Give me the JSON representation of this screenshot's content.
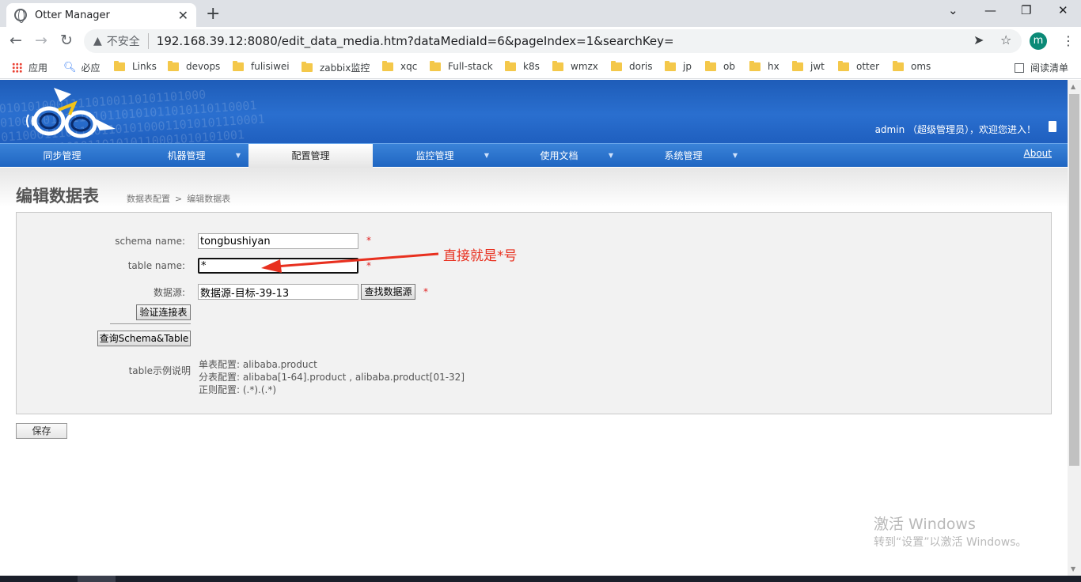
{
  "browser": {
    "tab_title": "Otter Manager",
    "tab_close": "✕",
    "new_tab": "+",
    "window_controls": {
      "minimize": "⌄",
      "restore": "—",
      "maximize": "❐",
      "close": "✕"
    },
    "security_label": "不安全",
    "url": "192.168.39.12:8080/edit_data_media.htm?dataMediaId=6&pageIndex=1&searchKey=",
    "profile_initial": "m",
    "bookmarks": [
      "应用",
      "必应",
      "Links",
      "devops",
      "fulisiwei",
      "zabbix监控",
      "xqc",
      "Full-stack",
      "k8s",
      "wmzx",
      "doris",
      "jp",
      "ob",
      "hx",
      "jwt",
      "otter",
      "oms"
    ],
    "reading_list": "阅读清单"
  },
  "header": {
    "welcome": "admin （超级管理员），欢迎您进入！"
  },
  "nav": {
    "items": [
      {
        "label": "同步管理",
        "has_menu": false
      },
      {
        "label": "机器管理",
        "has_menu": true
      },
      {
        "label": "配置管理",
        "has_menu": false,
        "active": true
      },
      {
        "label": "监控管理",
        "has_menu": true
      },
      {
        "label": "使用文档",
        "has_menu": true
      },
      {
        "label": "系统管理",
        "has_menu": true
      }
    ],
    "about": "About"
  },
  "page": {
    "title": "编辑数据表",
    "breadcrumb": {
      "parent": "数据表配置",
      "separator": ">",
      "current": "编辑数据表"
    }
  },
  "form": {
    "schema_label": "schema name:",
    "schema_value": "tongbushiyan",
    "table_label": "table name:",
    "table_value": "*",
    "source_label": "数据源:",
    "source_value": "数据源-目标-39-13",
    "find_source_button": "查找数据源",
    "verify_button": "验证连接表",
    "query_button": "查询Schema&Table",
    "required_mark": "*",
    "example_label": "table示例说明",
    "examples": [
      "单表配置: alibaba.product",
      "分表配置: alibaba[1-64].product , alibaba.product[01-32]",
      "正则配置: (.*).(.*)"
    ],
    "save_button": "保存"
  },
  "annotation": {
    "text": "直接就是*号",
    "color": "#e8301f"
  },
  "watermark": {
    "line1": "激活 Windows",
    "line2": "转到“设置”以激活 Windows。"
  },
  "colors": {
    "banner": "#2a6fcf",
    "nav": "#1f66c2",
    "required": "#e02020"
  }
}
